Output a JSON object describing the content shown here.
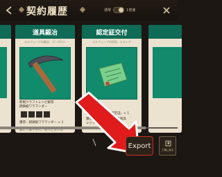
{
  "header": {
    "title": "契約履歴",
    "toggle_label": "通常",
    "toggle_value_label": "1倍速"
  },
  "cards": [
    {
      "title": "道具鍛冶",
      "subtitle": "エルフェーブの鍛冶、デンガロン",
      "lines": [
        "新規クラフトレシピ解禁",
        "鋼鉄級ワラマンダー",
        "獲得：鋼鉄級ワラマンダー × 1",
        "腰にて振り手に、石った方が用"
      ]
    },
    {
      "title": "認定証交付",
      "subtitle": "エルフェーブの研究、レティア",
      "lines": [
        "獲得：レジック「認定証」× 1",
        "獲得 1以上のアイテムの残高",
        "レジックの残留値 × 1 ?"
      ]
    }
  ],
  "footer": {
    "export_label": "Export",
    "side_button_label": "工場に戻る"
  },
  "colors": {
    "accent_green": "#0f6b55",
    "highlight_red": "#cf2f22",
    "parchment": "#ece2d0"
  },
  "icons": {
    "back": "back-arrow-icon",
    "close": "close-icon",
    "pickaxe": "pickaxe-icon",
    "scroll": "scroll-icon",
    "annotation": "red-arrow-icon"
  }
}
